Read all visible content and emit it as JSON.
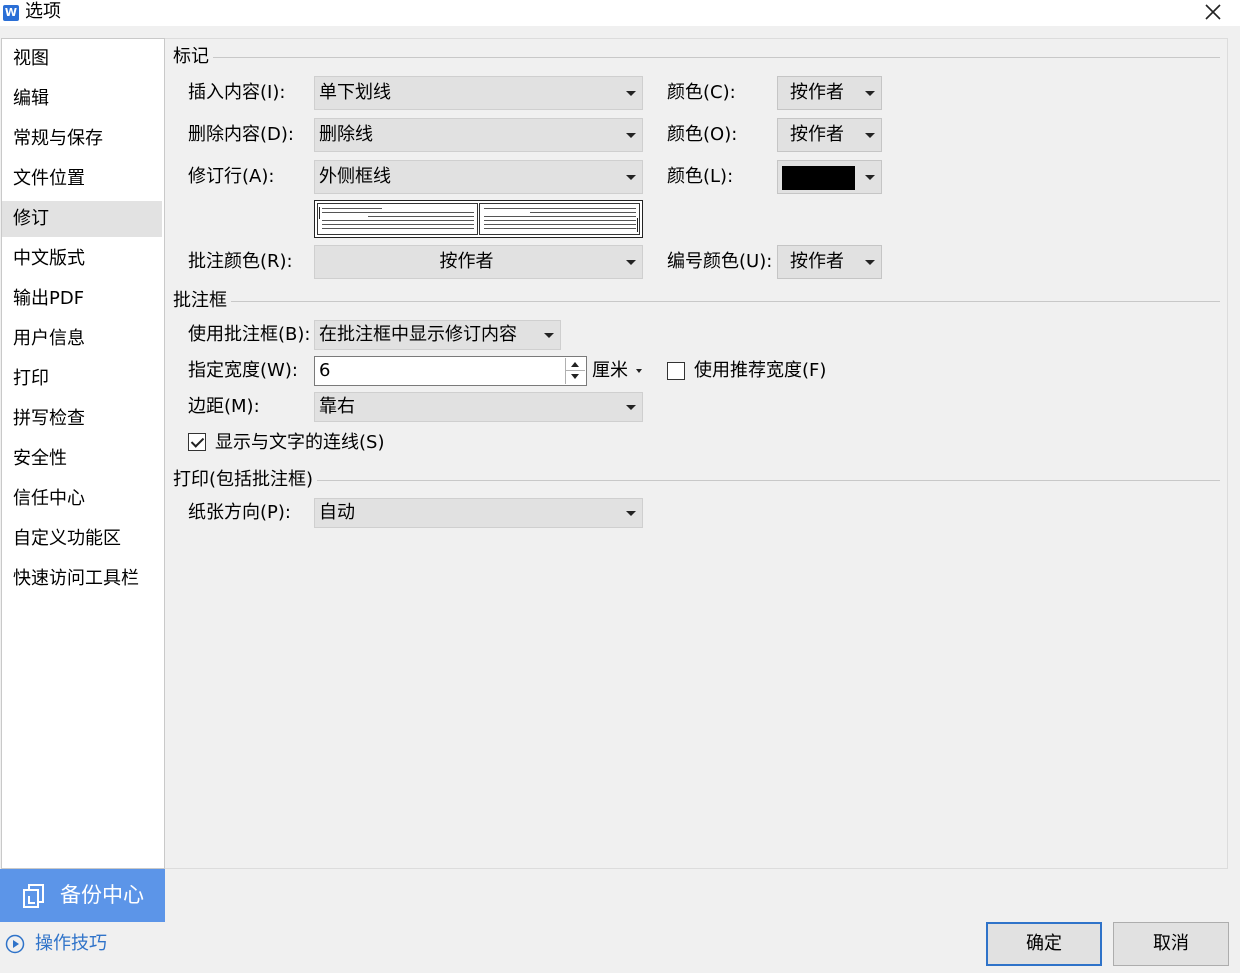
{
  "window": {
    "title": "选项",
    "app_icon_letter": "W"
  },
  "sidebar": {
    "items": [
      {
        "label": "视图"
      },
      {
        "label": "编辑"
      },
      {
        "label": "常规与保存"
      },
      {
        "label": "文件位置"
      },
      {
        "label": "修订",
        "selected": true
      },
      {
        "label": "中文版式"
      },
      {
        "label": "输出PDF"
      },
      {
        "label": "用户信息"
      },
      {
        "label": "打印"
      },
      {
        "label": "拼写检查"
      },
      {
        "label": "安全性"
      },
      {
        "label": "信任中心"
      },
      {
        "label": "自定义功能区"
      },
      {
        "label": "快速访问工具栏"
      }
    ],
    "backup_label": "备份中心",
    "tips_label": "操作技巧"
  },
  "markup": {
    "section_title": "标记",
    "insert_label": "插入内容(I):",
    "insert_value": "单下划线",
    "insert_color_label": "颜色(C):",
    "insert_color_value": "按作者",
    "delete_label": "删除内容(D):",
    "delete_value": "删除线",
    "delete_color_label": "颜色(O):",
    "delete_color_value": "按作者",
    "revline_label": "修订行(A):",
    "revline_value": "外侧框线",
    "revline_color_label": "颜色(L):",
    "revline_color_swatch": "#000000",
    "comment_color_label": "批注颜色(R):",
    "comment_color_value": "按作者",
    "number_color_label": "编号颜色(U):",
    "number_color_value": "按作者"
  },
  "balloons": {
    "section_title": "批注框",
    "use_label": "使用批注框(B):",
    "use_value": "在批注框中显示修订内容",
    "width_label": "指定宽度(W):",
    "width_value": "6",
    "width_unit": "厘米",
    "recommended_width_label": "使用推荐宽度(F)",
    "recommended_width_checked": false,
    "margin_label": "边距(M):",
    "margin_value": "靠右",
    "show_lines_label": "显示与文字的连线(S)",
    "show_lines_checked": true
  },
  "printing": {
    "section_title": "打印(包括批注框)",
    "orientation_label": "纸张方向(P):",
    "orientation_value": "自动"
  },
  "footer": {
    "ok_label": "确定",
    "cancel_label": "取消"
  },
  "colors": {
    "accent": "#2f73c9",
    "backup_bg": "#5c95e8"
  }
}
